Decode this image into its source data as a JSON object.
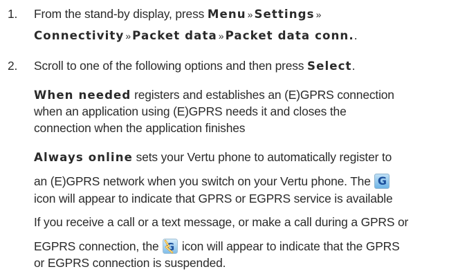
{
  "steps": [
    {
      "number": "1.",
      "line1": {
        "prefix": "From the stand-by display, press ",
        "kw1": "Menu",
        "sep1": "»",
        "kw2": "Settings",
        "sep2": "»"
      },
      "line2": {
        "kw3": "Connectivity",
        "sep3": "»",
        "kw4": "Packet data",
        "sep4": "»",
        "kw5": "Packet data conn.",
        "end": "."
      }
    },
    {
      "number": "2.",
      "prefix": "Scroll to one of the following options and then press ",
      "kw": "Select",
      "end": "."
    }
  ],
  "when_needed": {
    "term": "When needed",
    "line1": " registers and establishes an (E)GPRS connection",
    "line2": "when an application using (E)GPRS needs it and closes the",
    "line3": "connection when the application finishes"
  },
  "always_online": {
    "term": "Always online",
    "line1": " sets your Vertu phone to automatically register to",
    "line2": "an (E)GPRS network when you switch on your Vertu phone. The ",
    "line3": "icon will appear to indicate that GPRS or EGPRS service is available",
    "icon_letter": "G",
    "icon": "gprs-g-icon"
  },
  "suspended": {
    "line1": "If you receive a call or a text message, or make a call during a GPRS or",
    "line2a": "EGPRS connection, the ",
    "line2b": " icon will appear to indicate that the GPRS",
    "line3": "or EGPRS connection is suspended.",
    "icon": "gprs-suspended-icon"
  }
}
